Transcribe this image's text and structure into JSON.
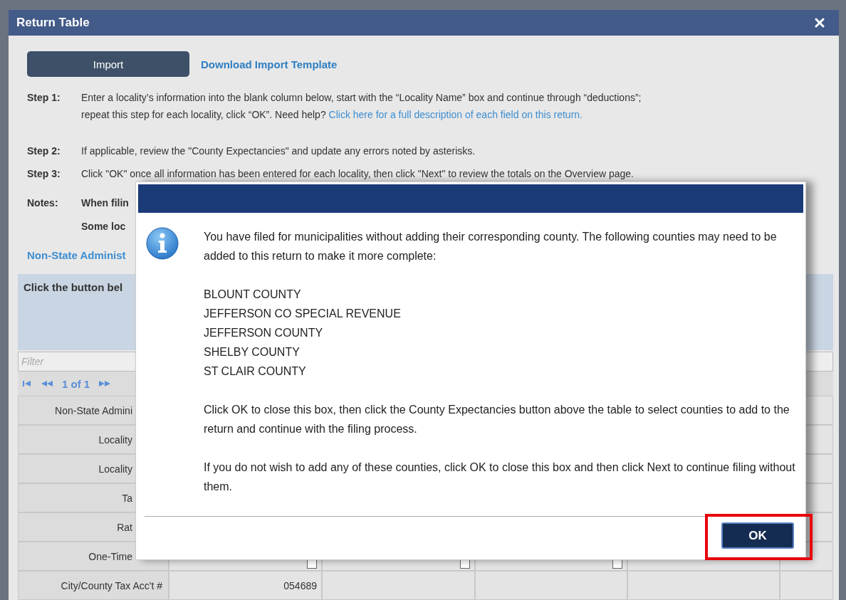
{
  "window": {
    "title": "Return Table"
  },
  "import_button": "Import",
  "template_link": "Download Import Template",
  "steps": [
    {
      "label": "Step 1:",
      "text": "Enter a locality’s information into the blank column below, start with the “Locality Name” box and continue through “deductions”; repeat this step for each locality, click “OK”. Need help? ",
      "link": "Click here for a full description of each field on this return."
    },
    {
      "label": "Step 2:",
      "text": "If applicable, review the \"County Expectancies\" and update any errors noted by asterisks."
    },
    {
      "label": "Step 3:",
      "text": "Click \"OK\" once all information has been entered for each locality, then click \"Next\" to review the totals on the Overview page."
    }
  ],
  "notes": {
    "label": "Notes:",
    "lines": [
      "When filin",
      "Some loc"
    ]
  },
  "section_link": "Non-State Administ",
  "panel_text": "Click the button bel",
  "filter": {
    "placeholder": "Filter"
  },
  "pager": {
    "label": "1 of 1"
  },
  "rows": [
    {
      "label": "Non-State Admini",
      "cells": []
    },
    {
      "label": "Locality",
      "cells": []
    },
    {
      "label": "Locality",
      "cells": []
    },
    {
      "label": "Ta",
      "cells": []
    },
    {
      "label": "Rat",
      "cells": []
    },
    {
      "kind": "checkbox",
      "label": "One-Time",
      "cells": [
        {
          "checked": false
        },
        {
          "checked": false
        },
        {
          "checked": false
        }
      ]
    },
    {
      "kind": "text",
      "label": "City/County Tax Acc't #",
      "cells": [
        "054689"
      ]
    }
  ],
  "dialog": {
    "message": [
      "You have filed for municipalities without adding their corresponding county. The following counties may need to be added to this return to make it more complete:"
    ],
    "counties": [
      "BLOUNT COUNTY",
      "JEFFERSON CO SPECIAL REVENUE",
      "JEFFERSON COUNTY",
      "SHELBY COUNTY",
      "ST CLAIR COUNTY"
    ],
    "instructions": [
      "Click OK to close this box, then click the County Expectancies button above the table to select counties to add to the return and continue with the filing process.",
      "If you do not wish to add any of these counties, click OK to close this box and then click Next to continue filing without them."
    ],
    "ok_button": "OK",
    "ok_highlighted": true
  }
}
